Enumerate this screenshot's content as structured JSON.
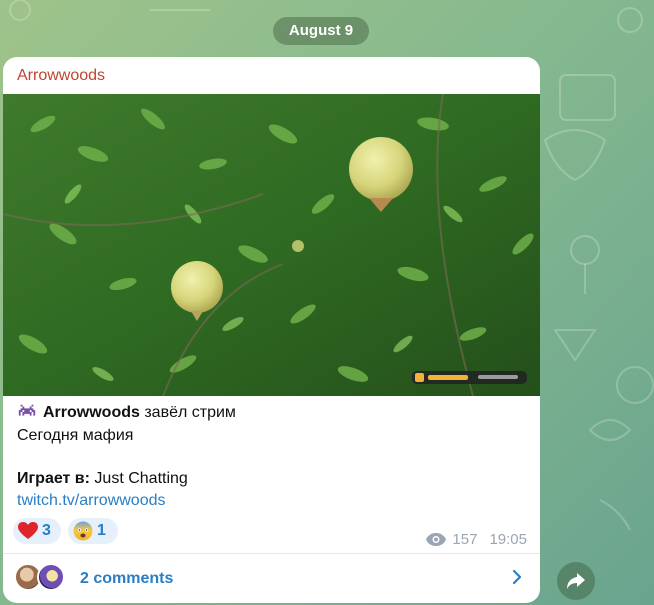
{
  "date_separator": "August 9",
  "message": {
    "channel_name": "Arrowwoods",
    "photo_icon": "pomegranate-tree-photo",
    "stream": {
      "emoji": "space-invader-emoji",
      "streamer": "Arrowwoods",
      "action": "завёл стрим"
    },
    "description": "Сегодня мафия",
    "playing_label": "Играет в:",
    "playing_value": "Just Chatting",
    "link": "twitch.tv/arrowwoods",
    "reactions": [
      {
        "icon": "heart-emoji",
        "count": "3"
      },
      {
        "icon": "fearful-face-emoji",
        "count": "1"
      }
    ],
    "views": "157",
    "time": "19:05",
    "comments_label": "2 comments"
  },
  "colors": {
    "channel_name": "#c0442f",
    "link": "#2a7ec4",
    "reaction_bg": "#e6f0fa",
    "meta": "#9aa6b2"
  }
}
